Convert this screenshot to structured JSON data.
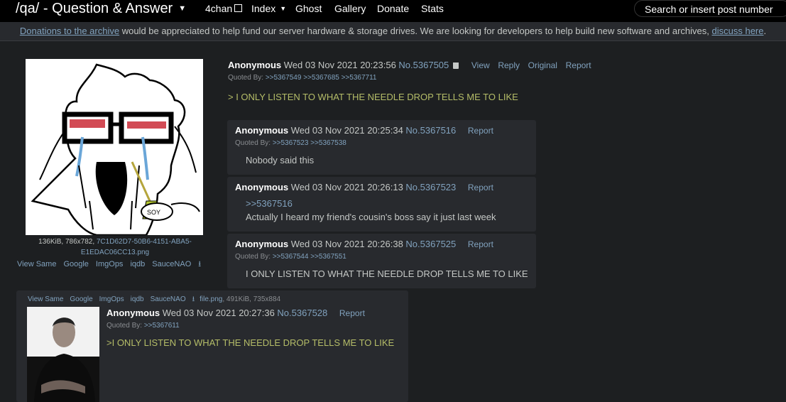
{
  "topbar": {
    "title": "/qa/ - Question & Answer",
    "nav": [
      {
        "label": "4chan"
      },
      {
        "label": "Index"
      },
      {
        "label": "Ghost"
      },
      {
        "label": "Gallery"
      },
      {
        "label": "Donate"
      },
      {
        "label": "Stats"
      }
    ],
    "search_placeholder": "Search or insert post number"
  },
  "banner": {
    "link1": "Donations to the archive",
    "text": " would be appreciated to help fund our server hardware & storage drives. We are looking for developers to help build new software and archives, ",
    "link2": "discuss here",
    "end": "."
  },
  "op": {
    "file_info_plain": "136KiB, 786x782, ",
    "file_name": "7C1D62D7-50B6-4151-ABA5-E1EDAC06CC13.png",
    "tools": [
      "View Same",
      "Google",
      "ImgOps",
      "iqdb",
      "SauceNAO"
    ],
    "name": "Anonymous",
    "date": "Wed 03 Nov 2021 20:23:56",
    "num": "No.5367505",
    "controls": [
      "View",
      "Reply",
      "Original",
      "Report"
    ],
    "quoted_label": "Quoted By:",
    "quoted": ">>5367549 >>5367685 >>5367711",
    "message": "> I ONLY LISTEN TO WHAT THE NEEDLE DROP TELLS ME TO LIKE"
  },
  "replies": [
    {
      "name": "Anonymous",
      "date": "Wed 03 Nov 2021 20:25:34",
      "num": "No.5367516",
      "report": "Report",
      "quoted_label": "Quoted By:",
      "quoted": ">>5367523 >>5367538",
      "message": "Nobody said this"
    },
    {
      "name": "Anonymous",
      "date": "Wed 03 Nov 2021 20:26:13",
      "num": "No.5367523",
      "report": "Report",
      "quote_link": ">>5367516",
      "message": "Actually I heard my friend's cousin's boss say it just last week"
    },
    {
      "name": "Anonymous",
      "date": "Wed 03 Nov 2021 20:26:38",
      "num": "No.5367525",
      "report": "Report",
      "quoted_label": "Quoted By:",
      "quoted": ">>5367544 >>5367551",
      "message": "I ONLY LISTEN TO WHAT THE NEEDLE DROP TELLS ME TO LIKE"
    },
    {
      "tools": [
        "View Same",
        "Google",
        "ImgOps",
        "iqdb",
        "SauceNAO"
      ],
      "file_name": "file.png",
      "file_meta": ", 491KiB, 735x884",
      "name": "Anonymous",
      "date": "Wed 03 Nov 2021 20:27:36",
      "num": "No.5367528",
      "report": "Report",
      "quoted_label": "Quoted By:",
      "quoted": ">>5367611",
      "message": ">I ONLY LISTEN TO WHAT THE NEEDLE DROP TELLS ME TO LIKE"
    }
  ],
  "colors": {
    "background": "#1d1f21",
    "post_bg": "#282a2e",
    "link": "#81a2be",
    "greentext": "#b5bd68"
  },
  "icons": [
    "trash-icon",
    "download-icon",
    "external-link-icon",
    "chevron-down-icon"
  ]
}
